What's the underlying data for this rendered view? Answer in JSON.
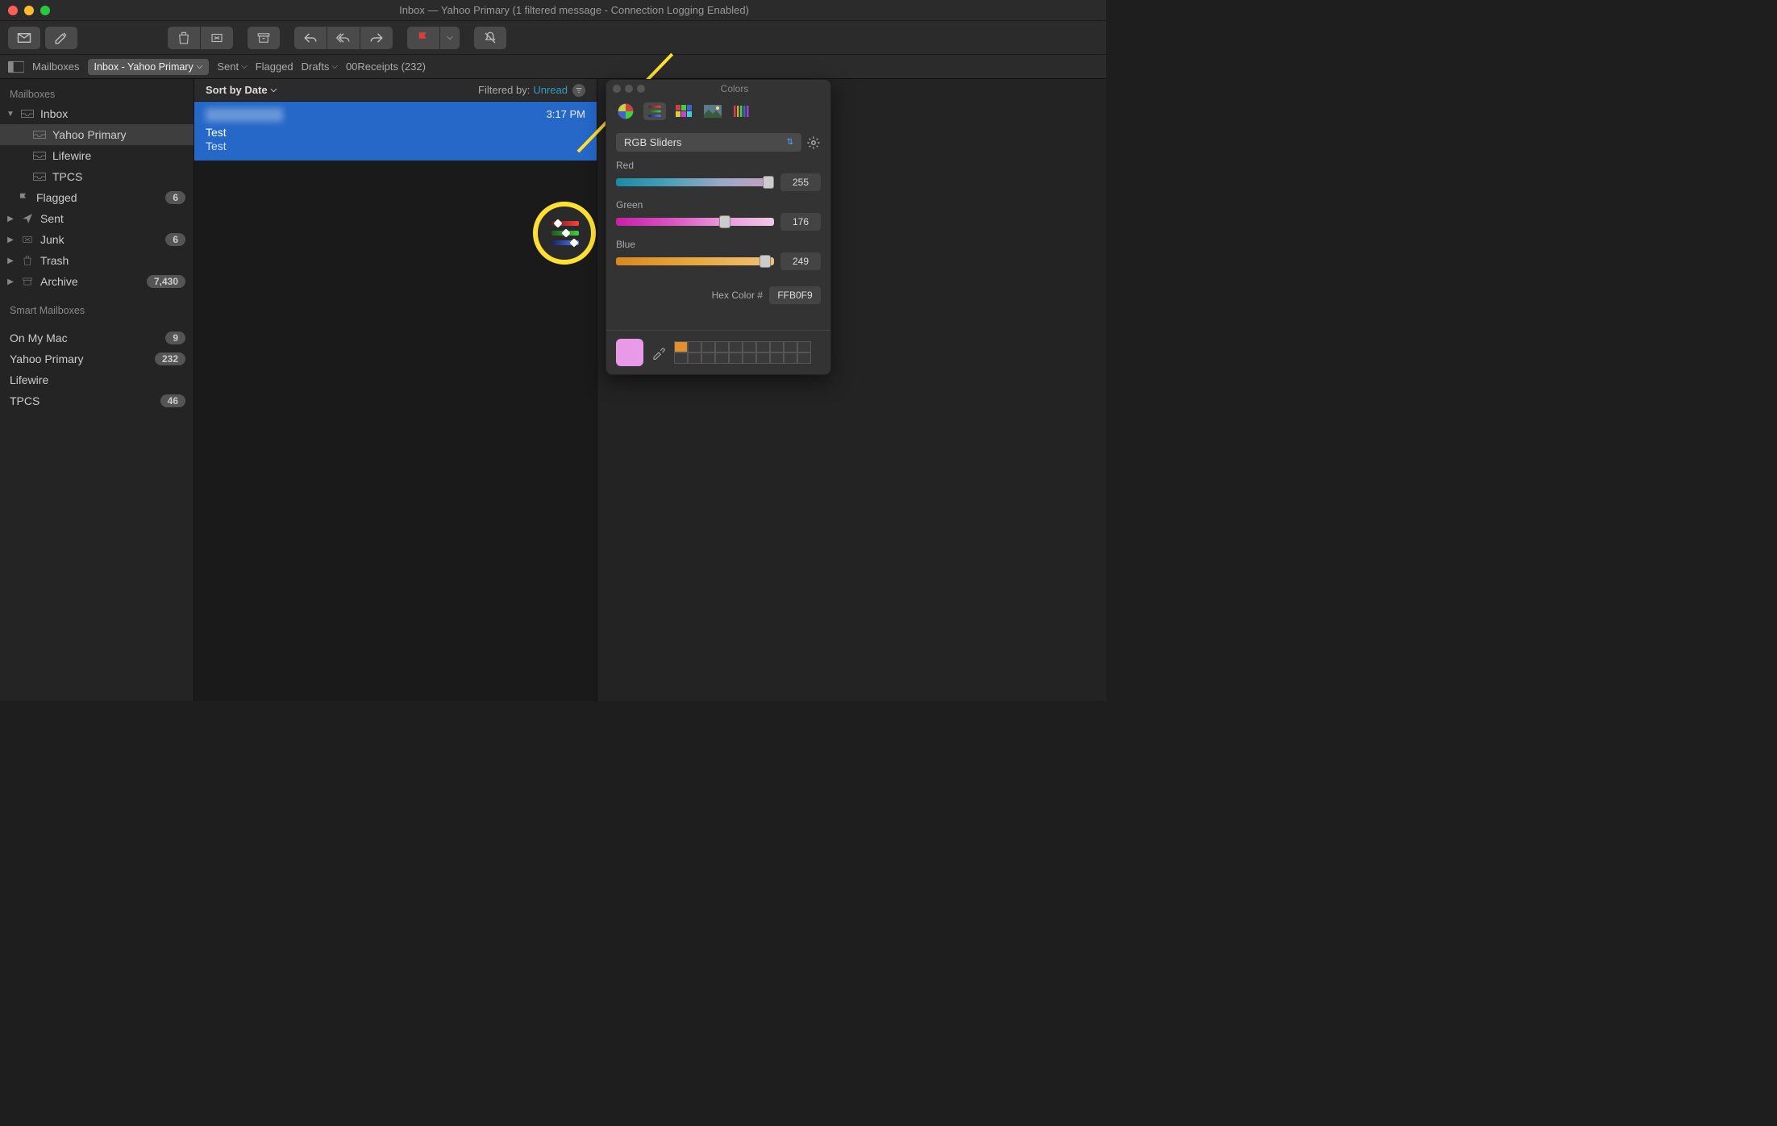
{
  "window": {
    "title": "Inbox — Yahoo Primary (1 filtered message - Connection Logging Enabled)"
  },
  "filterbar": {
    "mailboxes": "Mailboxes",
    "current": "Inbox - Yahoo Primary",
    "sent": "Sent",
    "flagged": "Flagged",
    "drafts": "Drafts",
    "receipts": "00Receipts (232)"
  },
  "sidebar": {
    "heading_mailboxes": "Mailboxes",
    "inbox": "Inbox",
    "inbox_children": [
      "Yahoo Primary",
      "Lifewire",
      "TPCS"
    ],
    "flagged": {
      "label": "Flagged",
      "count": "6"
    },
    "sent": "Sent",
    "junk": {
      "label": "Junk",
      "count": "6"
    },
    "trash": "Trash",
    "archive": {
      "label": "Archive",
      "count": "7,430"
    },
    "smart_heading": "Smart Mailboxes",
    "onmymac": {
      "label": "On My Mac",
      "count": "9"
    },
    "yahoo_primary": {
      "label": "Yahoo Primary",
      "count": "232"
    },
    "lifewire": "Lifewire",
    "tpcs": {
      "label": "TPCS",
      "count": "46"
    }
  },
  "list": {
    "sort": "Sort by Date",
    "filtered_by_label": "Filtered by:",
    "filtered_by_value": "Unread",
    "message": {
      "time": "3:17 PM",
      "subject": "Test",
      "preview": "Test"
    }
  },
  "colors": {
    "title": "Colors",
    "mode": "RGB Sliders",
    "red_label": "Red",
    "red_value": "255",
    "green_label": "Green",
    "green_value": "176",
    "blue_label": "Blue",
    "blue_value": "249",
    "hex_label": "Hex Color #",
    "hex_value": "FFB0F9"
  }
}
